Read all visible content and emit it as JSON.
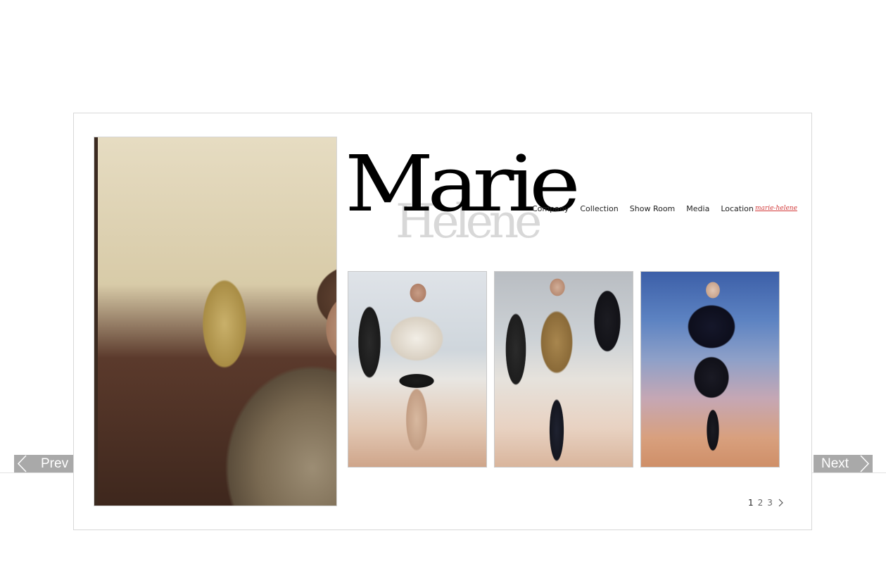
{
  "logo": {
    "main": "Marie",
    "sub": "Helene"
  },
  "nav": {
    "items": [
      {
        "label": "Company"
      },
      {
        "label": "Collection"
      },
      {
        "label": "Show Room"
      },
      {
        "label": "Media"
      },
      {
        "label": "Location"
      }
    ],
    "brand_link": "marie-helene"
  },
  "pager": {
    "pages": [
      "1",
      "2",
      "3"
    ],
    "current": "1",
    "next_icon": "chevron-right-icon"
  },
  "buttons": {
    "prev": "Prev",
    "next": "Next"
  },
  "colors": {
    "nav_brand": "#d23a3a",
    "nav_button_bg": "#a9a9a9",
    "frame_border": "#d8d8d8"
  }
}
